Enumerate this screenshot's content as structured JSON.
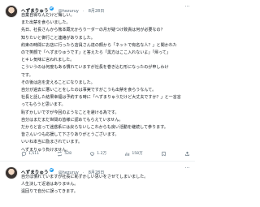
{
  "posts": [
    {
      "author_name": "へずまりゅう",
      "handle": "@hezuruy",
      "date": "8月28日",
      "lines": [
        "自業自得なんだけど悔しい。",
        "また出禁を食らいました。",
        "先日、社長さんから熊本蔵元からりーダーの月が疑つけ致責は何が必要なの？",
        "知りたいと御行こと連絡がありました。",
        "約束の時間にお店に行ったら店員さん達の顔から「ネットで有名な人？」と聞かれた",
        "ので笑顔で「へずまりゅうです」と答えたら「黒方はここ入れないよ」「帰って」",
        "とキレ気味に言われました。",
        "こういうのは何度もある慣れていますが社長を巻き込む形になったのが申しわけ",
        "です。",
        "その後は店を変えることになりました。",
        "自分が過去に悪いことをしたのは事実ですがこうも出禁を食らうなんて。",
        "社長と話した結果幸福は予約する時に「へずまりゅうだけど大丈夫ですか？」と一言言",
        "ってもらうと思います。",
        "恥ずかしいですが今回のようなことを避ける為です。",
        "自分はまだまだ世間の皆様に認めてもらえていません。",
        "だからと言って迷惑系には戻らないしこれからも良い活動を継続して参ります。",
        "皆さんいつも応援して下さりありがとうございます。",
        "いいね本当に励まされています。",
        "へずまりゅう負けません。"
      ],
      "stats": {
        "replies": "1,511",
        "reposts": "528",
        "likes": "1.2万",
        "views": "158万"
      }
    },
    {
      "author_name": "へずまりゅう",
      "handle": "@hezuruy",
      "date": "8月28日",
      "lines": [
        "自分は慣れていますが社長に恥ずかしい思いをさせてしまいました。",
        "人生決して近道はありません。",
        "遠回りで自分に誤ってきます。"
      ]
    }
  ],
  "icons": {
    "reply": "reply-icon",
    "repost": "repost-icon",
    "like": "like-icon",
    "views": "views-icon",
    "bookmark": "bookmark-icon",
    "share": "share-icon",
    "more": "more-icon",
    "verified": "verified-badge"
  },
  "colors": {
    "text": "#0f1419",
    "muted": "#536471",
    "verified": "#1d9bf0"
  }
}
